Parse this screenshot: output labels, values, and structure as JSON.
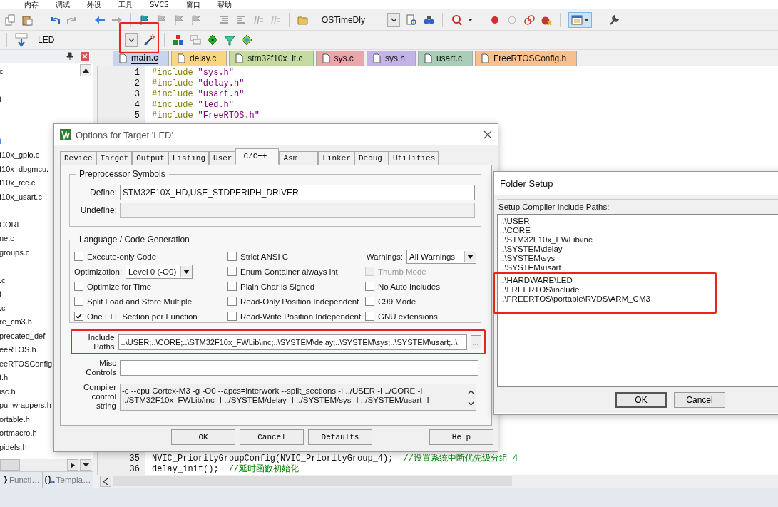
{
  "menu": [
    {
      "label": "内存"
    },
    {
      "label": "调试"
    },
    {
      "label": "外设"
    },
    {
      "label": "工具"
    },
    {
      "label": "SVCS"
    },
    {
      "label": "窗口"
    },
    {
      "label": "帮助"
    }
  ],
  "toolbar": {
    "find_combo": "OSTimeDly",
    "target_combo": "LED"
  },
  "project_panel": {
    "items": [
      {
        "kind": "file",
        "text": "c"
      },
      {
        "kind": "spacer"
      },
      {
        "kind": "file",
        "text": "t"
      },
      {
        "kind": "spacer"
      },
      {
        "kind": "spacer"
      },
      {
        "kind": "link",
        "text": "t"
      },
      {
        "kind": "file",
        "text": "f10x_gpio.c"
      },
      {
        "kind": "file",
        "text": "f10x_dbgmcu."
      },
      {
        "kind": "file",
        "text": "f10x_rcc.c"
      },
      {
        "kind": "file",
        "text": "f10x_usart.c"
      },
      {
        "kind": "spacer"
      },
      {
        "kind": "file",
        "text": "CORE"
      },
      {
        "kind": "file",
        "text": "ne.c"
      },
      {
        "kind": "file",
        "text": "groups.c"
      },
      {
        "kind": "spacer"
      },
      {
        "kind": "file",
        "text": ".c"
      },
      {
        "kind": "file",
        "text": "t"
      },
      {
        "kind": "file",
        "text": ".c"
      },
      {
        "kind": "file",
        "text": "re_cm3.h"
      },
      {
        "kind": "file",
        "text": "precated_defi"
      },
      {
        "kind": "file",
        "text": "eeRTOS.h"
      },
      {
        "kind": "file",
        "text": "eeRTOSConfig."
      },
      {
        "kind": "file",
        "text": "t.h"
      },
      {
        "kind": "file",
        "text": "isc.h"
      },
      {
        "kind": "file",
        "text": "pu_wrappers.h"
      },
      {
        "kind": "file",
        "text": "ortable.h"
      },
      {
        "kind": "file",
        "text": "ortmacro.h"
      },
      {
        "kind": "file",
        "text": "pidefs.h"
      }
    ],
    "bottom_tabs": [
      {
        "label": "Functi…",
        "selected": false
      },
      {
        "label": "Templa…",
        "selected": false
      }
    ]
  },
  "editor": {
    "tabs": [
      {
        "label": "main.c",
        "color": "#c8d4ec",
        "selected": true
      },
      {
        "label": "delay.c",
        "color": "#f9d77e",
        "selected": false
      },
      {
        "label": "stm32f10x_it.c",
        "color": "#c5dba0",
        "selected": false
      },
      {
        "label": "sys.c",
        "color": "#eba6ab",
        "selected": false
      },
      {
        "label": "sys.h",
        "color": "#c3b3e6",
        "selected": false
      },
      {
        "label": "usart.c",
        "color": "#a9cdb6",
        "selected": false
      },
      {
        "label": "FreeRTOSConfig.h",
        "color": "#f7c08e",
        "selected": false
      }
    ],
    "lines_top": [
      {
        "number": "1",
        "tokens": [
          {
            "kind": "directive",
            "text": "#include"
          },
          {
            "kind": "string",
            "text": "\"sys.h\""
          }
        ]
      },
      {
        "number": "2",
        "tokens": [
          {
            "kind": "directive",
            "text": "#include"
          },
          {
            "kind": "string",
            "text": "\"delay.h\""
          }
        ]
      },
      {
        "number": "3",
        "tokens": [
          {
            "kind": "directive",
            "text": "#include"
          },
          {
            "kind": "string",
            "text": "\"usart.h\""
          }
        ]
      },
      {
        "number": "4",
        "tokens": [
          {
            "kind": "directive",
            "text": "#include"
          },
          {
            "kind": "string",
            "text": "\"led.h\""
          }
        ]
      },
      {
        "number": "5",
        "tokens": [
          {
            "kind": "directive",
            "text": "#include"
          },
          {
            "kind": "string",
            "text": "\"FreeRTOS.h\""
          }
        ]
      }
    ],
    "lines_bottom": [
      {
        "number": "35",
        "tokens": [
          {
            "kind": "plain",
            "text": "NVIC_PriorityGroupConfig(NVIC_PriorityGroup_4);"
          },
          {
            "kind": "comment",
            "text": "//设置系统中断优先级分组 4"
          }
        ]
      },
      {
        "number": "36",
        "tokens": [
          {
            "kind": "plain",
            "text": "delay_init();"
          },
          {
            "kind": "comment",
            "text": "//延时函数初始化"
          }
        ]
      }
    ]
  },
  "options_dialog": {
    "title": "Options for Target 'LED'",
    "tabs": [
      {
        "label": "Device",
        "selected": false
      },
      {
        "label": "Target",
        "selected": false
      },
      {
        "label": "Output",
        "selected": false
      },
      {
        "label": "Listing",
        "selected": false
      },
      {
        "label": "User",
        "selected": false
      },
      {
        "label": "C/C++",
        "selected": true
      },
      {
        "label": "Asm",
        "selected": false
      },
      {
        "label": "Linker",
        "selected": false
      },
      {
        "label": "Debug",
        "selected": false
      },
      {
        "label": "Utilities",
        "selected": false
      }
    ],
    "preprocessor": {
      "title": "Preprocessor Symbols",
      "define_label": "Define:",
      "define": "STM32F10X_HD,USE_STDPERIPH_DRIVER",
      "undefine_label": "Undefine:"
    },
    "language": {
      "title": "Language / Code Generation",
      "col1": [
        {
          "kind": "checkbox",
          "label": "Execute-only Code",
          "checked": false
        },
        {
          "kind": "select",
          "label": "Optimization:",
          "value": "Level 0 (-O0)"
        },
        {
          "kind": "checkbox",
          "label": "Optimize for Time",
          "checked": false
        },
        {
          "kind": "checkbox",
          "label": "Split Load and Store Multiple",
          "checked": false
        },
        {
          "kind": "checkbox",
          "label": "One ELF Section per Function",
          "checked": true
        }
      ],
      "col2": [
        {
          "kind": "checkbox",
          "label": "Strict ANSI C",
          "checked": false
        },
        {
          "kind": "checkbox",
          "label": "Enum Container always int",
          "checked": false
        },
        {
          "kind": "checkbox",
          "label": "Plain Char is Signed",
          "checked": false
        },
        {
          "kind": "checkbox",
          "label": "Read-Only Position Independent",
          "checked": false
        },
        {
          "kind": "checkbox",
          "label": "Read-Write Position Independent",
          "checked": false
        }
      ],
      "col3": [
        {
          "kind": "select",
          "label": "Warnings:",
          "value": "All Warnings"
        },
        {
          "kind": "checkbox",
          "label": "Thumb Mode",
          "checked": false,
          "disabled": true
        },
        {
          "kind": "checkbox",
          "label": "No Auto Includes",
          "checked": false,
          "disabled": false
        },
        {
          "kind": "checkbox",
          "label": "C99 Mode",
          "checked": false,
          "disabled": false
        },
        {
          "kind": "checkbox",
          "label": "GNU extensions",
          "checked": false,
          "disabled": false
        }
      ]
    },
    "include_label": "Include Paths",
    "include_paths": "..\\USER;..\\CORE;..\\STM32F10x_FWLib\\inc;..\\SYSTEM\\delay;..\\SYSTEM\\sys;..\\SYSTEM\\usart;..\\",
    "browse": "...",
    "misc_label": "Misc Controls",
    "compiler_label": "Compiler control string",
    "compiler_string": [
      "-c --cpu Cortex-M3 -g -O0 --apcs=interwork --split_sections -I ../USER -I ../CORE -I",
      "../STM32F10x_FWLib/inc -I ../SYSTEM/delay -I ../SYSTEM/sys -I ../SYSTEM/usart -I"
    ],
    "buttons": [
      "OK",
      "Cancel",
      "Defaults",
      "Help"
    ]
  },
  "folder_dialog": {
    "title": "Folder Setup",
    "label": "Setup Compiler Include Paths:",
    "paths": [
      "..\\USER",
      "..\\CORE",
      "..\\STM32F10x_FWLib\\inc",
      "..\\SYSTEM\\delay",
      "..\\SYSTEM\\sys",
      "..\\SYSTEM\\usart",
      "..\\HARDWARE\\LED",
      "..\\FREERTOS\\include",
      "..\\FREERTOS\\portable\\RVDS\\ARM_CM3"
    ],
    "buttons": [
      "OK",
      "Cancel"
    ]
  }
}
